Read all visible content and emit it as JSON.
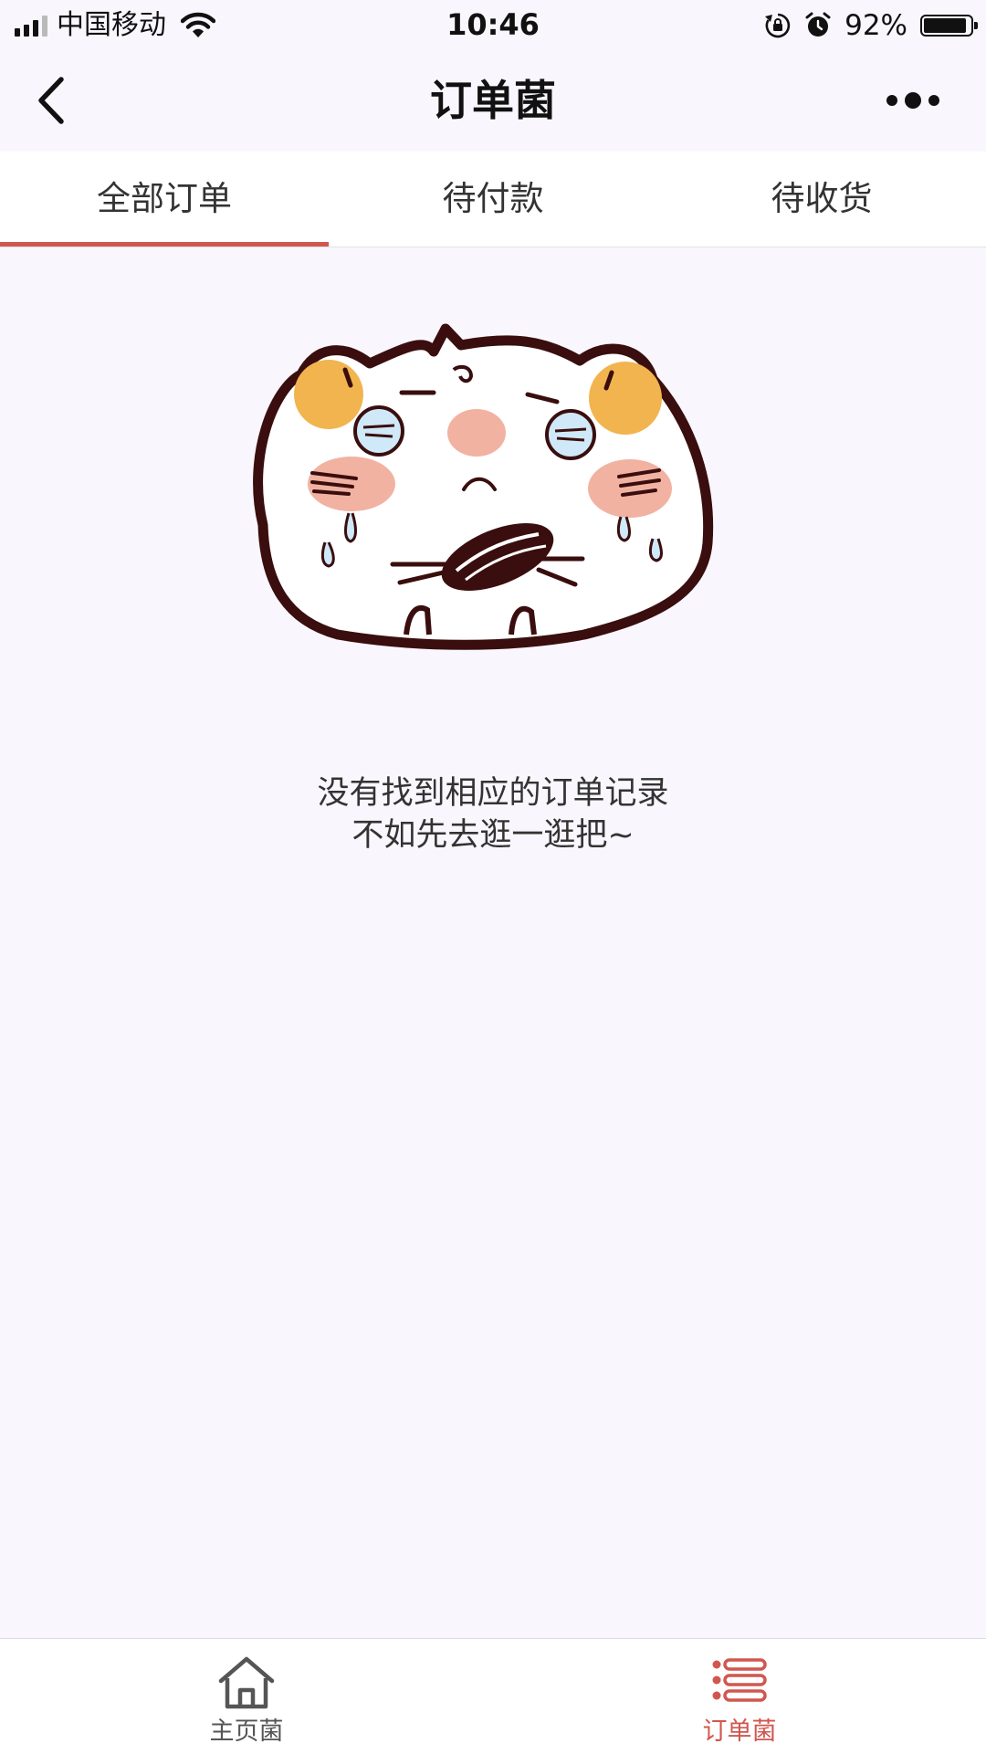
{
  "status_bar": {
    "carrier": "中国移动",
    "time": "10:46",
    "battery_percent": "92%",
    "battery_level": 0.92,
    "icons": [
      "signal-icon",
      "wifi-icon",
      "rotation-lock-icon",
      "alarm-icon",
      "battery-icon"
    ]
  },
  "header": {
    "title": "订单菌",
    "back_icon": "chevron-left-icon",
    "more_icon": "more-dots-icon"
  },
  "tabs": {
    "items": [
      {
        "label": "全部订单",
        "active": true
      },
      {
        "label": "待付款",
        "active": false
      },
      {
        "label": "待收货",
        "active": false
      }
    ]
  },
  "empty_state": {
    "illustration": "crying-hamster-illustration",
    "line1": "没有找到相应的订单记录",
    "line2": "不如先去逛一逛把~"
  },
  "tabbar": {
    "items": [
      {
        "label": "主页菌",
        "icon": "home-icon",
        "active": false
      },
      {
        "label": "订单菌",
        "icon": "order-list-icon",
        "active": true
      }
    ]
  },
  "colors": {
    "accent": "#d0574f",
    "background": "#f9f7fd",
    "surface": "#ffffff",
    "text": "#333333"
  }
}
